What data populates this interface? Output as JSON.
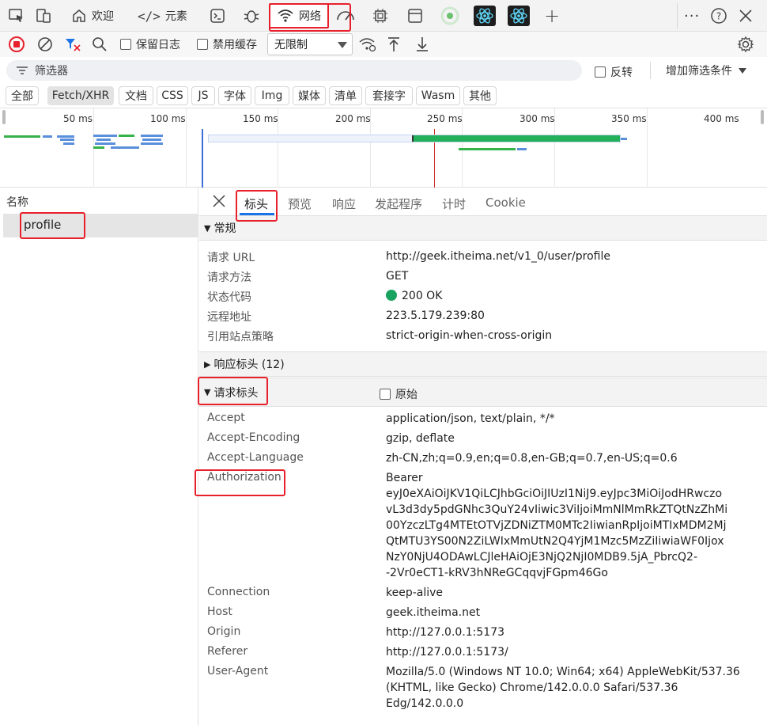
{
  "topbar": {
    "tabs": [
      {
        "label": "欢迎",
        "icon": "home-icon"
      },
      {
        "label": "元素",
        "icon": "code-icon"
      },
      {
        "label": "网络",
        "icon": "wifi-icon"
      }
    ],
    "accent_red": "#e8202b"
  },
  "toolbar": {
    "preserve_log": "保留日志",
    "disable_cache": "禁用缓存",
    "throttle": "无限制"
  },
  "filter": {
    "placeholder": "筛选器",
    "invert": "反转",
    "more_filters": "增加筛选条件"
  },
  "chips": [
    "全部",
    "Fetch/XHR",
    "文档",
    "CSS",
    "JS",
    "字体",
    "Img",
    "媒体",
    "清单",
    "套接字",
    "Wasm",
    "其他"
  ],
  "timeline": {
    "ticks": [
      "50 ms",
      "100 ms",
      "150 ms",
      "200 ms",
      "250 ms",
      "300 ms",
      "350 ms",
      "400 ms"
    ]
  },
  "requests": {
    "header": "名称",
    "rows": [
      "profile"
    ]
  },
  "details": {
    "tabs": [
      "标头",
      "预览",
      "响应",
      "发起程序",
      "计时",
      "Cookie"
    ],
    "general": {
      "title": "常规",
      "rows": [
        {
          "name": "请求 URL",
          "value": "http://geek.itheima.net/v1_0/user/profile"
        },
        {
          "name": "请求方法",
          "value": "GET"
        },
        {
          "name": "状态代码",
          "value": "200 OK"
        },
        {
          "name": "远程地址",
          "value": "223.5.179.239:80"
        },
        {
          "name": "引用站点策略",
          "value": "strict-origin-when-cross-origin"
        }
      ]
    },
    "response_headers": {
      "title": "响应标头 (12)"
    },
    "request_headers": {
      "title": "请求标头",
      "raw": "原始",
      "rows": [
        {
          "name": "Accept",
          "value": "application/json, text/plain, */*"
        },
        {
          "name": "Accept-Encoding",
          "value": "gzip, deflate"
        },
        {
          "name": "Accept-Language",
          "value": "zh-CN,zh;q=0.9,en;q=0.8,en-GB;q=0.7,en-US;q=0.6"
        },
        {
          "name": "Authorization",
          "value": "Bearer\neyJ0eXAiOiJKV1QiLCJhbGciOiJIUzI1NiJ9.eyJpc3MiOiJodHRwczo\nvL3d3dy5pdGNhc3QuY24vIiwic3ViIjoiMmNlMmRkZTQtNzZhMi\n00YzczLTg4MTEtOTVjZDNiZTM0MTc2IiwianRpIjoiMTIxMDM2Mj\nQtMTU3YS00N2ZiLWIxMmUtN2Q4YjM1Mzc5MzZiIiwiaWF0Ijox\nNzY0NjU4ODAwLCJleHAiOjE3NjQ2NjI0MDB9.5jA_PbrcQ2-\n-2Vr0eCT1-kRV3hNReGCqqvjFGpm46Go"
        },
        {
          "name": "Connection",
          "value": "keep-alive"
        },
        {
          "name": "Host",
          "value": "geek.itheima.net"
        },
        {
          "name": "Origin",
          "value": "http://127.0.0.1:5173"
        },
        {
          "name": "Referer",
          "value": "http://127.0.0.1:5173/"
        },
        {
          "name": "User-Agent",
          "value": "Mozilla/5.0 (Windows NT 10.0; Win64; x64) AppleWebKit/537.36\n(KHTML, like Gecko) Chrome/142.0.0.0 Safari/537.36\nEdg/142.0.0.0"
        }
      ]
    }
  }
}
